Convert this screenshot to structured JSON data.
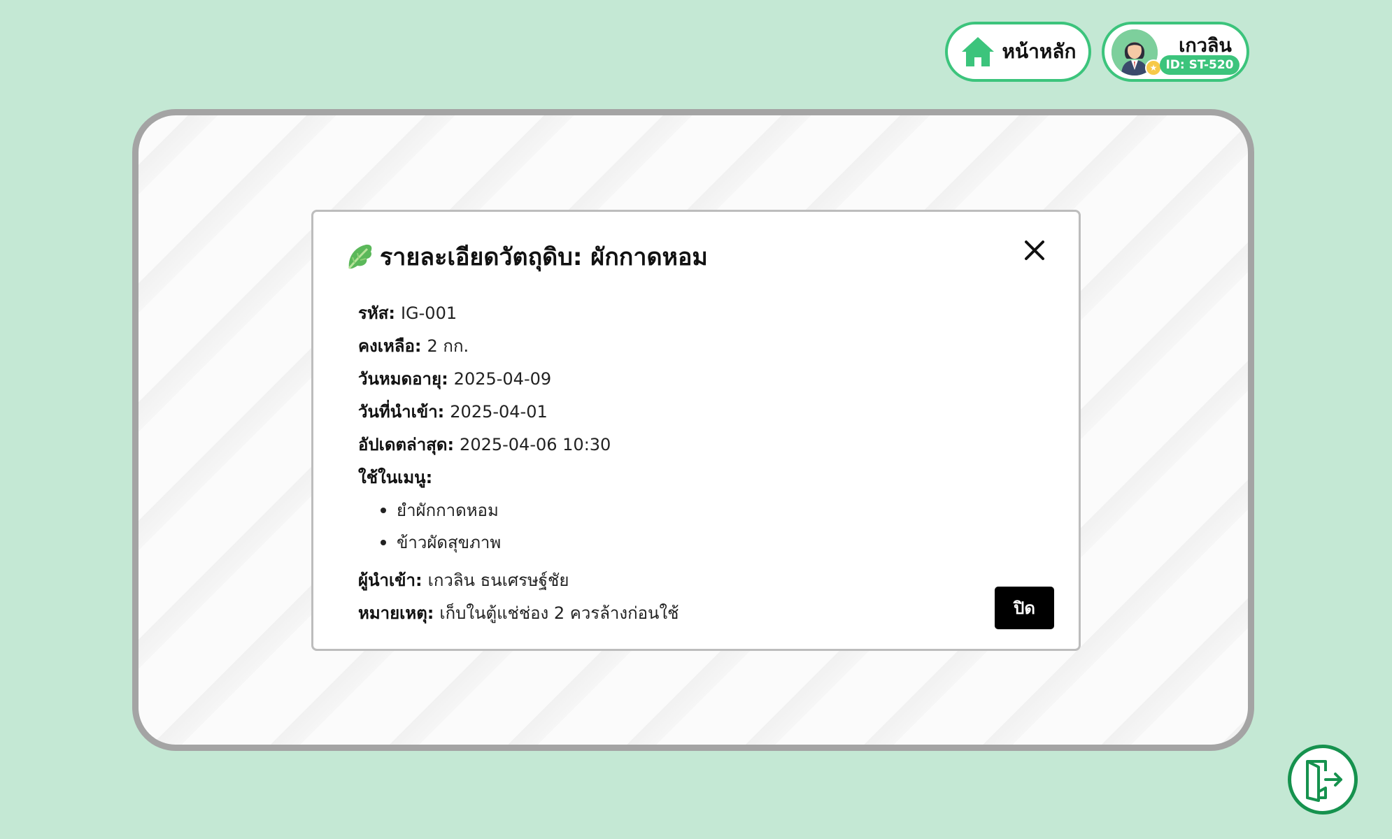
{
  "header": {
    "home_label": "หน้าหลัก",
    "user": {
      "name": "เกวลิน",
      "id_label": "ID: ST-520"
    }
  },
  "modal": {
    "title": "รายละเอียดวัตถุดิบ: ผักกาดหอม",
    "title_icon": "leafy-green-icon",
    "fields": {
      "code": {
        "label": "รหัส:",
        "value": "IG-001"
      },
      "remaining": {
        "label": "คงเหลือ:",
        "value": "2 กก."
      },
      "expiry": {
        "label": "วันหมดอายุ:",
        "value": "2025-04-09"
      },
      "imported": {
        "label": "วันที่นำเข้า:",
        "value": "2025-04-01"
      },
      "updated": {
        "label": "อัปเดตล่าสุด:",
        "value": "2025-04-06 10:30"
      },
      "menus_label": "ใช้ในเมนู:",
      "importer": {
        "label": "ผู้นำเข้า:",
        "value": "เกวลิน ธนเศรษฐ์ชัย"
      },
      "note": {
        "label": "หมายเหตุ:",
        "value": "เก็บในตู้แช่ช่อง 2 ควรล้างก่อนใช้"
      }
    },
    "menus": [
      "ยำผักกาดหอม",
      "ข้าวผัดสุขภาพ"
    ],
    "close_button_label": "ปิด"
  },
  "colors": {
    "background": "#c4e8d4",
    "accent": "#3cc47c",
    "logout": "#16924e",
    "card_border": "#a4a4a4"
  },
  "icons": {
    "home": "home-icon",
    "avatar": "user-avatar-icon",
    "close": "close-icon",
    "logout": "logout-door-icon"
  }
}
